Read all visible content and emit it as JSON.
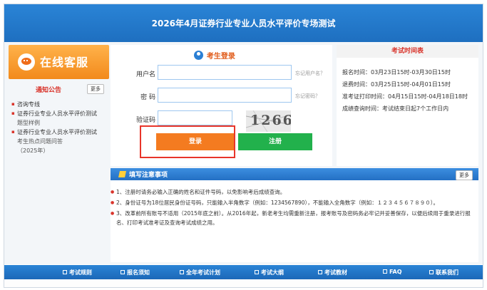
{
  "banner": {
    "title": "2026年4月证券行业专业人员水平评价专场测试"
  },
  "service": {
    "label": "在线客服"
  },
  "notice": {
    "title": "通知公告",
    "more": "更多",
    "items": [
      "咨询专线",
      "证券行业专业人员水平评价测试",
      "题型样例",
      "证券行业专业人员水平评价测试",
      "考生热点问题问答",
      "（2025年）"
    ]
  },
  "login": {
    "title": "考生登录",
    "username_label": "用户名",
    "username_value": "",
    "forgot_username": "忘记用户名？",
    "password_label": "密  码",
    "password_value": "",
    "forgot_password": "忘记密码？",
    "captcha_label": "验证码",
    "captcha_value": "",
    "captcha_text": "1266",
    "login_button": "登录",
    "register_button": "注册"
  },
  "exam_time": {
    "title": "考试时间表",
    "items": [
      "报名时间：03月23日15时-03月30日15时",
      "退费时间：03月25日15时-04月01日15时",
      "准考证打印时间：04月15日15时-04月18日18时",
      "成绩查询时间：考试结束日起7个工作日内"
    ]
  },
  "notes": {
    "title": "填写注意事项",
    "more": "更多",
    "items": [
      "1、注册时请务必输入正确的姓名和证件号码，以免影响考后成绩查询。",
      "2、身份证号为18位居民身份证号码，只能输入半角数字（例如：1234567890），不能输入全角数字（例如：１２３４５６７８９０）。",
      "3、改革前所有账号不适用（2015年底之前）。从2016年起，新老考生均需重新注册，报考账号及密码务必牢记并妥善保存，以便后续用于重录进行报名、打印考试准考证及查询考试成绩之用。"
    ]
  },
  "footer": {
    "items": [
      "考试规则",
      "报名须知",
      "全年考试计划",
      "考试大纲",
      "考试教材",
      "FAQ",
      "联系我们"
    ]
  }
}
